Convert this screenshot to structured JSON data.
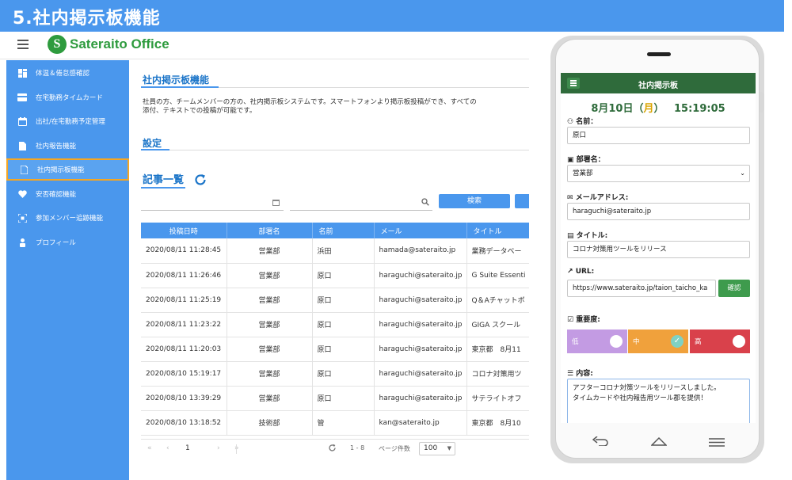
{
  "banner": {
    "title": "5.社内掲示板機能"
  },
  "header": {
    "logo_mark": "S",
    "logo_text": "Sateraito Office"
  },
  "sidebar": {
    "items": [
      {
        "label": "体温＆倦怠感確認",
        "icon": "grid-icon"
      },
      {
        "label": "在宅勤務タイムカード",
        "icon": "card-icon"
      },
      {
        "label": "出社/在宅勤務予定管理",
        "icon": "calendar-icon"
      },
      {
        "label": "社内報告機能",
        "icon": "document-icon"
      },
      {
        "label": "社内掲示板機能",
        "icon": "document-icon",
        "active": true
      },
      {
        "label": "安否確認機能",
        "icon": "heart-icon"
      },
      {
        "label": "参加メンバー追跡機能",
        "icon": "qr-icon"
      },
      {
        "label": "プロフィール",
        "icon": "person-icon"
      }
    ]
  },
  "main": {
    "title": "社内掲示板機能",
    "description_line1": "社員の方、チームメンバーの方の、社内掲示板システムです。スマートフォンより掲示板投稿ができ、すべての",
    "description_line2": "添付、テキストでの投稿が可能です。",
    "settings_title": "設定",
    "articles_title": "記事一覧",
    "search_label": "検索"
  },
  "table": {
    "columns": [
      "投稿日時",
      "部署名",
      "名前",
      "メール",
      "タイトル"
    ],
    "rows": [
      [
        "2020/08/11 11:28:45",
        "営業部",
        "浜田",
        "hamada@sateraito.jp",
        "業務データベー"
      ],
      [
        "2020/08/11 11:26:46",
        "営業部",
        "原口",
        "haraguchi@sateraito.jp",
        "G Suite Essenti"
      ],
      [
        "2020/08/11 11:25:19",
        "営業部",
        "原口",
        "haraguchi@sateraito.jp",
        "Q＆Aチャットボ"
      ],
      [
        "2020/08/11 11:23:22",
        "営業部",
        "原口",
        "haraguchi@sateraito.jp",
        "GIGA スクール"
      ],
      [
        "2020/08/11 11:20:03",
        "営業部",
        "原口",
        "haraguchi@sateraito.jp",
        "東京都　8月11"
      ],
      [
        "2020/08/10 15:19:17",
        "営業部",
        "原口",
        "haraguchi@sateraito.jp",
        "コロナ対策用ツ"
      ],
      [
        "2020/08/10 13:39:29",
        "営業部",
        "原口",
        "haraguchi@sateraito.jp",
        "サテライトオフ"
      ],
      [
        "2020/08/10 13:18:52",
        "技術部",
        "管",
        "kan@sateraito.jp",
        "東京都　8月10"
      ]
    ]
  },
  "pager": {
    "first": "«",
    "prev": "‹",
    "page": "1",
    "next": "›",
    "last": "»",
    "page_size_label": "ページ件数",
    "page_size": "100",
    "range": "1 - 8"
  },
  "phone": {
    "app_title": "社内掲示板",
    "date": "8月10日（",
    "dow": "月",
    "date_end": "）",
    "time": "15:19:05",
    "name_label": "名前：",
    "name_value": "原口",
    "dept_label": "部署名：",
    "dept_value": "営業部",
    "email_label": "メールアドレス:",
    "email_value": "haraguchi@sateraito.jp",
    "title_label": "タイトル:",
    "title_value": "コロナ対策用ツールをリリース",
    "url_label": "URL:",
    "url_value": "https://www.sateraito.jp/taion_taicho_ka",
    "confirm_label": "確認",
    "priority_label": "重要度:",
    "priorities": [
      {
        "label": "低",
        "color": "#c39be3"
      },
      {
        "label": "中",
        "color": "#f0a13c",
        "selected": true
      },
      {
        "label": "高",
        "color": "#d9414b"
      }
    ],
    "content_label": "内容:",
    "content_line1": "アフターコロナ対策ツールをリリースしました。",
    "content_line2": "タイムカードや社内報告用ツール郡を提供！"
  },
  "colors": {
    "accent": "#4a97ed",
    "active_border": "#f5a623",
    "app_green": "#2f6b3b"
  }
}
